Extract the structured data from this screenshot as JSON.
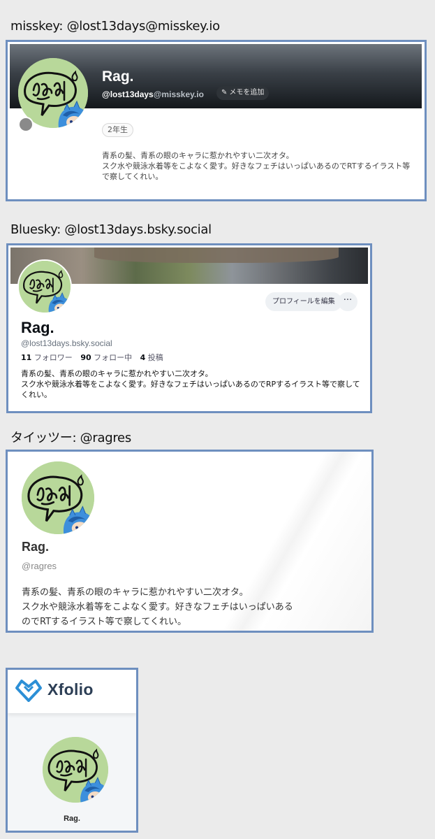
{
  "misskey": {
    "label": "misskey: @lost13days@misskey.io",
    "name": "Rag.",
    "handle_user": "@lost13days",
    "handle_host": "@misskey.io",
    "memo_button": "メモを追加",
    "badge": "2年生",
    "bio": "青系の髪、青系の眼のキャラに惹かれやすい二次オタ。\nスク水や競泳水着等をこよなく愛す。好きなフェチはいっぱいあるのでRTするイラスト等で察してくれい。"
  },
  "bluesky": {
    "label": "Bluesky: @lost13days.bsky.social",
    "name": "Rag.",
    "handle": "@lost13days.bsky.social",
    "followers_count": "11",
    "followers_label": "フォロワー",
    "following_count": "90",
    "following_label": "フォロー中",
    "posts_count": "4",
    "posts_label": "投稿",
    "edit_button": "プロフィールを編集",
    "more_button": "···",
    "bio": "青系の髪、青系の眼のキャラに惹かれやすい二次オタ。\nスク水や競泳水着等をこよなく愛す。好きなフェチはいっぱいあるのでRPするイラスト等で察してくれい。"
  },
  "taittsuu": {
    "label": "タイッツー: @ragres",
    "name": "Rag.",
    "handle": "@ragres",
    "bio": "青系の髪、青系の眼のキャラに惹かれやすい二次オタ。\nスク水や競泳水着等をこよなく愛す。好きなフェチはいっぱいある\nのでRTするイラスト等で察してくれい。"
  },
  "xfolio": {
    "logo_text": "Xfolio",
    "name": "Rag."
  },
  "colors": {
    "frame_border": "#6e8fbf",
    "avatar_bg": "#b8d89a",
    "xfolio_logo": "#2c8fd6"
  },
  "icons": [
    "avatar-image",
    "edit-icon",
    "status-dot",
    "more-icon",
    "xfolio-logo-icon"
  ]
}
